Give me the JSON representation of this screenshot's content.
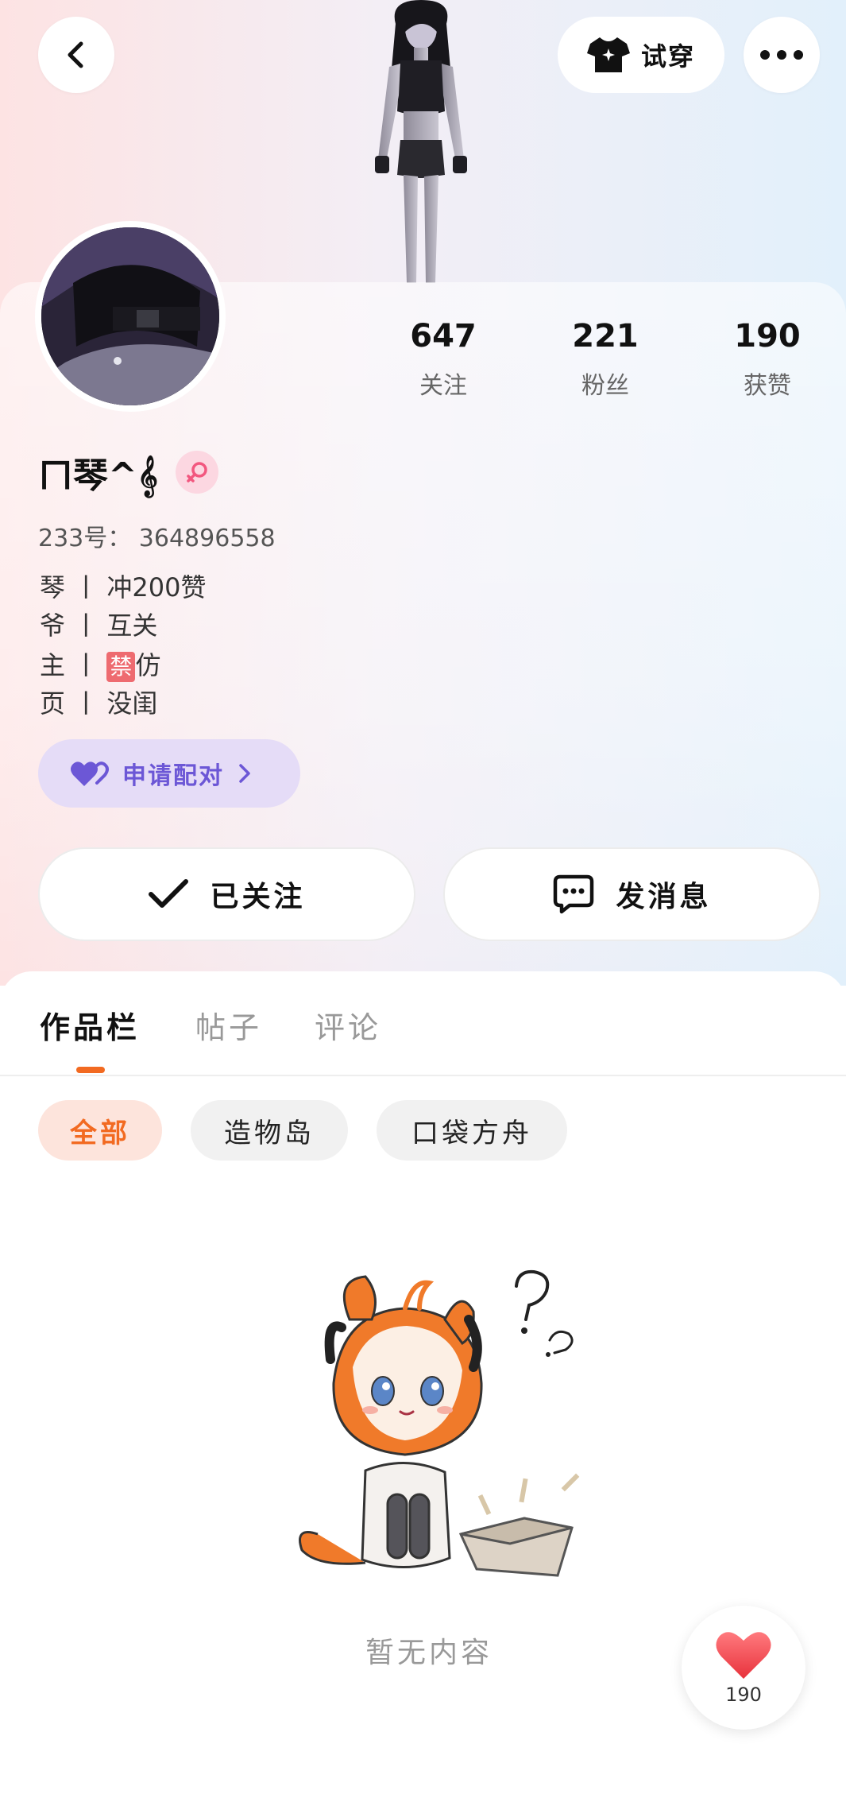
{
  "header": {
    "back_icon": "chevron-left-icon",
    "tryon_label": "试穿",
    "tryon_icon": "tshirt-icon",
    "more_icon": "more-horizontal-icon"
  },
  "profile": {
    "username": "ㄇ琴^𝄞",
    "gender_icon": "female-icon",
    "uid_text": "233号： 364896558",
    "bio": [
      {
        "key": "琴",
        "sep": "丨",
        "text": "冲200赞"
      },
      {
        "key": "爷",
        "sep": "丨",
        "text": "互关"
      },
      {
        "key": "主",
        "sep": "丨",
        "ban": "禁",
        "text": "仿"
      },
      {
        "key": "页",
        "sep": "丨",
        "text": "没闺"
      }
    ]
  },
  "stats": [
    {
      "value": "647",
      "label": "关注"
    },
    {
      "value": "221",
      "label": "粉丝"
    },
    {
      "value": "190",
      "label": "获赞"
    }
  ],
  "pair_button": {
    "label": "申请配对",
    "icon": "hearts-icon"
  },
  "actions": {
    "follow_label": "已关注",
    "follow_icon": "check-icon",
    "message_label": "发消息",
    "message_icon": "chat-icon"
  },
  "tabs": [
    {
      "label": "作品栏",
      "active": true
    },
    {
      "label": "帖子",
      "active": false
    },
    {
      "label": "评论",
      "active": false
    }
  ],
  "filters": [
    {
      "label": "全部",
      "active": true
    },
    {
      "label": "造物岛",
      "active": false
    },
    {
      "label": "口袋方舟",
      "active": false
    }
  ],
  "empty_state": {
    "text": "暂无内容"
  },
  "like_fab": {
    "count": "190",
    "icon": "heart-icon"
  },
  "colors": {
    "accent": "#f26a21",
    "pair_purple": "#6c57d6",
    "like_red": "#f0464e"
  }
}
